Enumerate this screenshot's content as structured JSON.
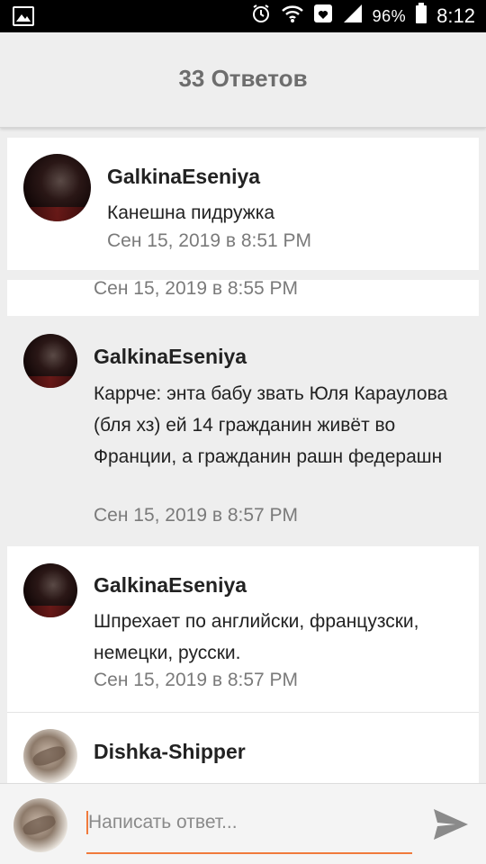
{
  "status_bar": {
    "battery": "96%",
    "time": "8:12"
  },
  "header": {
    "title": "33 Ответов"
  },
  "comments": [
    {
      "author": "GalkinaEseniya",
      "text": "Канешна пидружка",
      "date": "Сен 15, 2019 в 8:51 PM"
    },
    {
      "date": "Сен 15, 2019 в 8:55 PM"
    },
    {
      "author": "GalkinaEseniya",
      "text": "Каррче: энта бабу звать Юля Караулова (бля хз) ей 14 гражданин живёт во Франции, а гражданин рашн федерашн",
      "date": "Сен 15, 2019 в 8:57 PM"
    },
    {
      "author": "GalkinaEseniya",
      "text": "Шпрехает по английски, французски, немецки, русски.",
      "date": "Сен 15, 2019 в 8:57 PM"
    },
    {
      "author": "Dishka-Shipper"
    }
  ],
  "composer": {
    "placeholder": "Написать ответ..."
  },
  "icons": {
    "gallery": "gallery-icon",
    "alarm": "alarm-icon",
    "wifi": "wifi-icon",
    "heart": "heart-notification-icon",
    "signal": "signal-icon",
    "battery": "battery-icon",
    "send": "send-icon"
  },
  "colors": {
    "accent": "#f07a3c",
    "header_bg": "#eeeeee",
    "title": "#6d6d6d",
    "date": "#7a7a7a"
  }
}
